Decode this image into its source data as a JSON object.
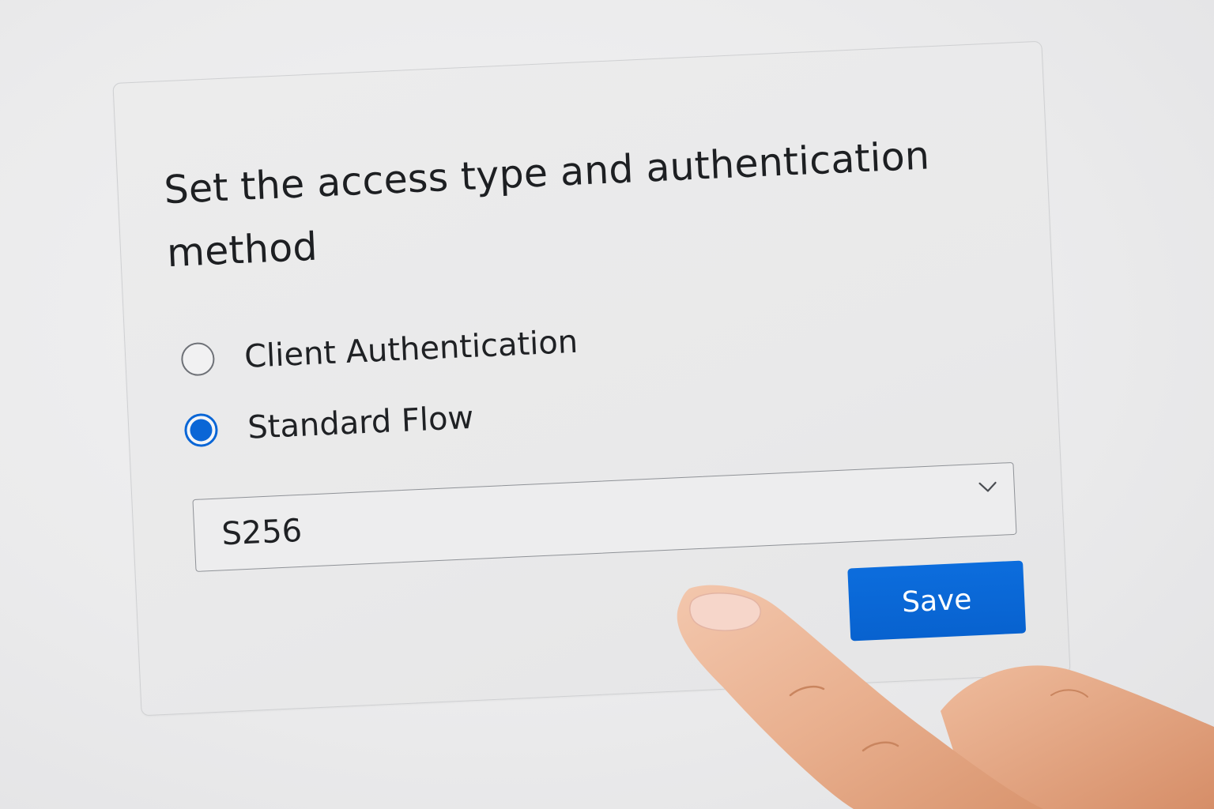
{
  "dialog": {
    "title": "Set the access type and authentication method",
    "options": [
      {
        "label": "Client Authentication",
        "selected": false
      },
      {
        "label": "Standard Flow",
        "selected": true
      }
    ],
    "select": {
      "value": "S256",
      "icon": "chevron-down-icon"
    },
    "save_label": "Save"
  },
  "colors": {
    "accent": "#0a66d6",
    "card_background": "#ebebeb",
    "text": "#1d1f22"
  }
}
